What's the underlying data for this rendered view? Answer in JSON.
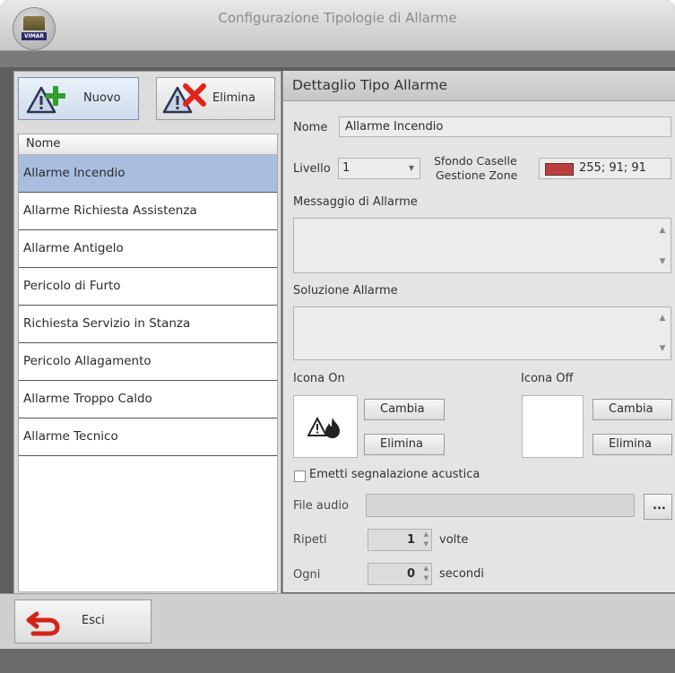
{
  "window": {
    "title": "Configurazione Tipologie di Allarme",
    "logo_text": "VIMAR"
  },
  "left_panel": {
    "buttons": {
      "new_label": "Nuovo",
      "delete_label": "Elimina"
    },
    "list_header": "Nome",
    "items": [
      "Allarme Incendio",
      "Allarme Richiesta Assistenza",
      "Allarme Antigelo",
      "Pericolo di Furto",
      "Richiesta Servizio in Stanza",
      "Pericolo Allagamento",
      "Allarme Troppo Caldo",
      "Allarme Tecnico"
    ],
    "selected_index": 0
  },
  "detail": {
    "header": "Dettaglio Tipo Allarme",
    "name_label": "Nome",
    "name_value": "Allarme Incendio",
    "level_label": "Livello",
    "level_value": "1",
    "bg_label_line1": "Sfondo Caselle",
    "bg_label_line2": "Gestione Zone",
    "bg_value": "255; 91; 91",
    "bg_color": "#b93f3f",
    "message_label": "Messaggio di Allarme",
    "message_value": "",
    "solution_label": "Soluzione Allarme",
    "solution_value": "",
    "icon_on_label": "Icona On",
    "icon_off_label": "Icona Off",
    "change_label": "Cambia",
    "delete_label": "Elimina",
    "sound_checkbox_label": "Emetti segnalazione acustica",
    "sound_checked": false,
    "audio_label": "File audio",
    "audio_value": "",
    "browse_label": "...",
    "repeat_label": "Ripeti",
    "repeat_value": "1",
    "repeat_unit": "volte",
    "every_label": "Ogni",
    "every_value": "0",
    "every_unit": "secondi"
  },
  "bottom": {
    "exit_label": "Esci"
  }
}
